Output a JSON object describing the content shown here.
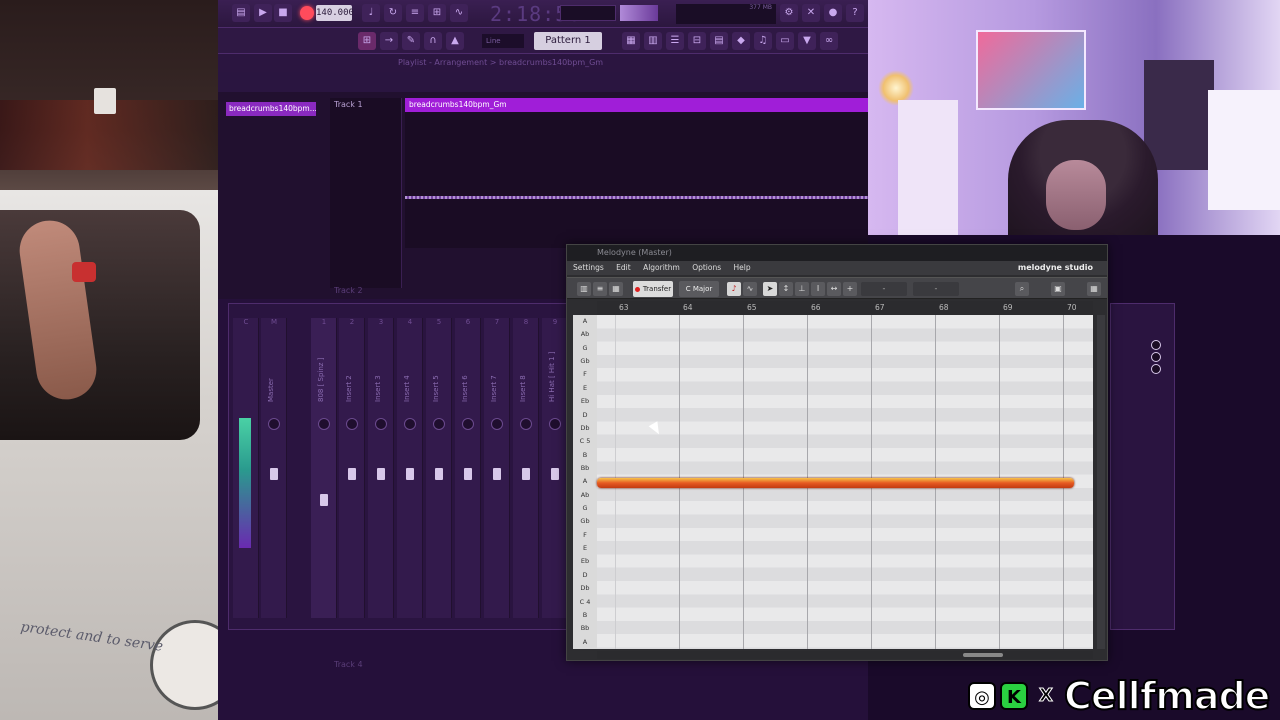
{
  "daw": {
    "tempo": "140.000",
    "clock": "2:18:56",
    "pattern": "Pattern 1",
    "snap": "Line",
    "cpu": "377 MB",
    "playlist_header": "Playlist - Arrangement > breadcrumbs140bpm_Gm",
    "pattern_item": "breadcrumbs140bpm...",
    "track1": "Track 1",
    "track2": "Track 2",
    "track4": "Track 4",
    "clip_name": "breadcrumbs140bpm_Gm",
    "mixer_strips": [
      "Master",
      "808 [ Spinz ]",
      "Insert 2",
      "Insert 3",
      "Insert 4",
      "Insert 5",
      "Insert 6",
      "Insert 7",
      "Insert 8",
      "Hi Hat [ Hit 1 ]"
    ],
    "mixer_nums": [
      "C",
      "M",
      "1",
      "2",
      "3",
      "4",
      "5",
      "6",
      "7",
      "8",
      "9"
    ]
  },
  "melodyne": {
    "title": "Melodyne (Master)",
    "logo": "melodyne studio",
    "menu": [
      "Settings",
      "Edit",
      "Algorithm",
      "Options",
      "Help"
    ],
    "transfer": "Transfer",
    "key": "C Major",
    "field1": "-",
    "field2": "-",
    "bars": [
      "63",
      "64",
      "65",
      "66",
      "67",
      "68",
      "69",
      "70"
    ],
    "keys": [
      "A",
      "Ab",
      "G",
      "Gb",
      "F",
      "E",
      "Eb",
      "D",
      "Db",
      "C 5",
      "B",
      "Bb",
      "A",
      "Ab",
      "G",
      "Gb",
      "F",
      "E",
      "Eb",
      "D",
      "Db",
      "C 4",
      "B",
      "Bb",
      "A"
    ]
  },
  "branding": {
    "name": "Cellfmade",
    "icons": [
      "instagram-icon",
      "kick-icon",
      "x-icon"
    ]
  },
  "camera_left": {
    "slogan": "protect and to serve"
  }
}
